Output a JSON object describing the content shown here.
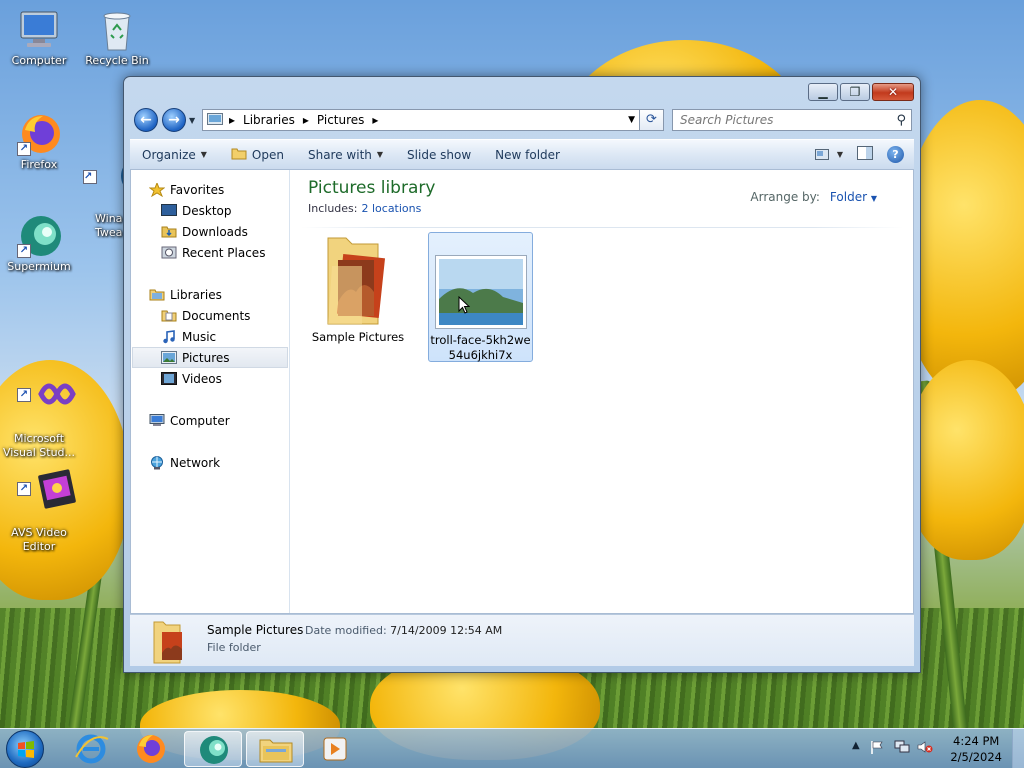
{
  "desktop": {
    "icons": [
      {
        "label": "Computer",
        "icon": "computer-icon"
      },
      {
        "label": "Recycle Bin",
        "icon": "recycle-bin-icon"
      },
      {
        "label": "Firefox",
        "icon": "firefox-icon"
      },
      {
        "label": "Wina\nTwea",
        "icon": "winaero-tweaker-icon"
      },
      {
        "label": "Supermium",
        "icon": "supermium-icon"
      },
      {
        "label": "Microsoft\nVisual Stud...",
        "icon": "visual-studio-icon"
      },
      {
        "label": "AVS Video\nEditor",
        "icon": "avs-video-editor-icon"
      }
    ]
  },
  "window": {
    "address": {
      "segments": [
        "Libraries",
        "Pictures"
      ]
    },
    "search_placeholder": "Search Pictures",
    "toolbar": {
      "organize": "Organize",
      "open": "Open",
      "share_with": "Share with",
      "slide_show": "Slide show",
      "new_folder": "New folder"
    },
    "nav": {
      "favorites": "Favorites",
      "desktop": "Desktop",
      "downloads": "Downloads",
      "recent_places": "Recent Places",
      "libraries": "Libraries",
      "documents": "Documents",
      "music": "Music",
      "pictures": "Pictures",
      "videos": "Videos",
      "computer": "Computer",
      "network": "Network"
    },
    "library": {
      "title": "Pictures library",
      "includes_label": "Includes:",
      "includes_link": "2 locations",
      "arrange_label": "Arrange by:",
      "arrange_value": "Folder"
    },
    "items": [
      {
        "name": "Sample Pictures",
        "type": "folder"
      },
      {
        "name_line1": "troll-face-5kh2we",
        "name_line2": "54u6jkhi7x",
        "type": "image"
      }
    ],
    "details": {
      "name": "Sample Pictures",
      "modified_label": "Date modified:",
      "modified_value": "7/14/2009 12:54 AM",
      "type": "File folder"
    }
  },
  "taskbar": {
    "time": "4:24 PM",
    "date": "2/5/2024"
  },
  "colors": {
    "library_title": "#1e6b2a",
    "link": "#1a53b0",
    "close_button": "#c23a1d"
  }
}
